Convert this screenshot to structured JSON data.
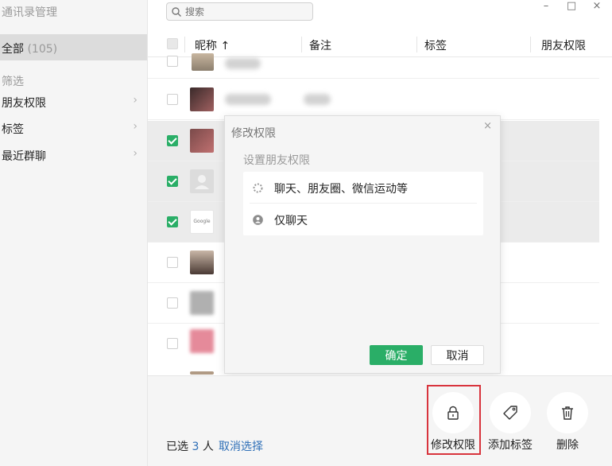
{
  "app_title": "通讯录管理",
  "sidebar": {
    "all_label": "全部",
    "all_count": "(105)",
    "filter_heading": "筛选",
    "items": [
      {
        "label": "朋友权限"
      },
      {
        "label": "标签"
      },
      {
        "label": "最近群聊"
      }
    ]
  },
  "search": {
    "placeholder": "搜索"
  },
  "window_controls": {
    "minimize": "–",
    "maximize": "□",
    "close": "×"
  },
  "table": {
    "headers": {
      "nickname": "昵称 ↑",
      "remark": "备注",
      "tags": "标签",
      "permission": "朋友权限"
    },
    "rows": [
      {
        "checked": false
      },
      {
        "checked": false
      },
      {
        "checked": true
      },
      {
        "checked": true
      },
      {
        "checked": true,
        "avatar_text": "Google"
      },
      {
        "checked": false
      },
      {
        "checked": false
      },
      {
        "checked": false
      }
    ]
  },
  "modal": {
    "title": "修改权限",
    "close": "×",
    "heading": "设置朋友权限",
    "options": [
      {
        "label": "聊天、朋友圈、微信运动等"
      },
      {
        "label": "仅聊天"
      }
    ],
    "confirm": "确定",
    "cancel": "取消"
  },
  "bottom": {
    "selected_prefix": "已选",
    "selected_count": "3",
    "selected_suffix": "人",
    "deselect": "取消选择",
    "actions": [
      {
        "label": "修改权限",
        "icon": "lock-icon"
      },
      {
        "label": "添加标签",
        "icon": "tag-icon"
      },
      {
        "label": "删除",
        "icon": "trash-icon"
      }
    ]
  },
  "colors": {
    "accent": "#2aae67",
    "link": "#2e6fb7",
    "highlight": "#d8343d"
  }
}
